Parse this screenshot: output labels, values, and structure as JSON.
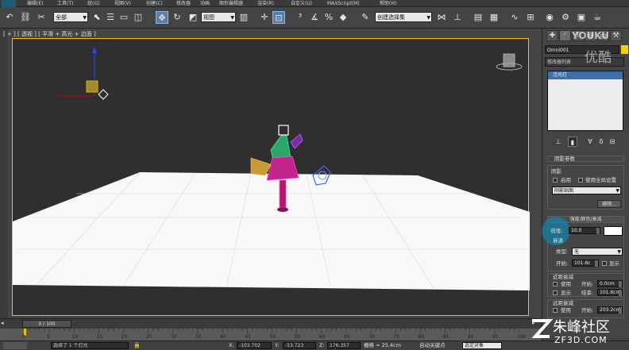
{
  "menubar": {
    "items": [
      "编辑(E)",
      "工具(T)",
      "组(G)",
      "视图(V)",
      "创建(C)",
      "修改器",
      "动画",
      "图形编辑器",
      "渲染(R)",
      "自定义(U)",
      "MAXScript(M)",
      "帮助(H)"
    ]
  },
  "toolbar": {
    "filter_value": "全部",
    "ref_coord_value": "视图",
    "selection_set_value": "创建选择集"
  },
  "viewport": {
    "label": "[ + ] [ 透视 ] [ 平滑 + 高光 + 边面 ]"
  },
  "command_panel": {
    "object_name": "Omni001",
    "object_color": "#f3d200",
    "modifier_list_label": "修改器列表",
    "stack_item": "泛光灯",
    "shadow_rollout": {
      "title": "阴影",
      "enable_label": "启用",
      "use_global_label": "使用全局设置",
      "shadow_type": "阴影贴图",
      "exclude_button": "排除..."
    },
    "intensity_rollout": {
      "title": "强度/颜色/衰减",
      "multiplier_label": "倍增:",
      "multiplier_value": "10.0",
      "multiplier_color": "#ffffff",
      "decay_label": "衰退",
      "type_label": "类型:",
      "type_value": "无",
      "start_label": "开始:",
      "start_value": "101.6c",
      "show_label": "显示"
    },
    "near_atten": {
      "title": "近距衰减",
      "use_label": "使用",
      "start_label": "开始:",
      "start_value": "0.0cm",
      "show_label": "显示",
      "end_label": "结束:",
      "end_value": "101.6cm"
    },
    "far_atten": {
      "title": "远距衰减",
      "use_label": "使用",
      "start_label": "开始:",
      "start_value": "203.2cm"
    },
    "rollout_top_title": "阴影参数"
  },
  "timeline": {
    "frame_display": "0 / 100",
    "ticks": [
      "0",
      "5",
      "10",
      "15",
      "20",
      "25",
      "30",
      "35",
      "40",
      "45",
      "50",
      "55",
      "60",
      "65",
      "70",
      "75",
      "80",
      "85",
      "90",
      "95",
      "100"
    ]
  },
  "statusbar": {
    "selection": "选择了 1 个灯光",
    "x_label": "X:",
    "x_value": "-103.702",
    "y_label": "Y:",
    "y_value": "-53.723",
    "z_label": "Z:",
    "z_value": "176.357",
    "grid": "栅格 = 25.4cm",
    "autokey": "自动关键点",
    "selected": "选定对象"
  },
  "watermarks": {
    "youku": "YOUKU",
    "youku_cn": "优酷",
    "zf_cn": "朱峰社区",
    "zf_en": "ZF3D.COM"
  }
}
